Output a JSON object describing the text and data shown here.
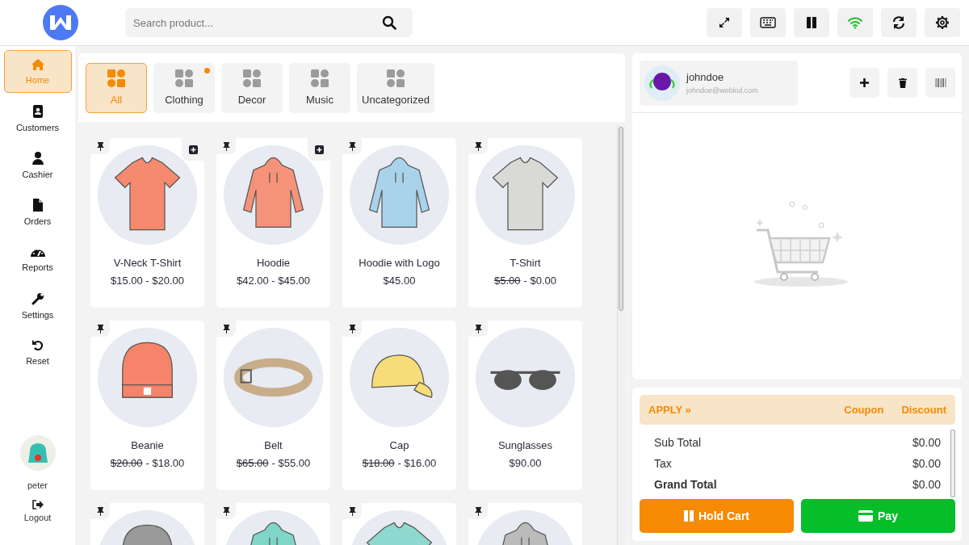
{
  "header": {
    "search": {
      "placeholder": "Search product..."
    },
    "tools": [
      {
        "kind": "expand"
      },
      {
        "kind": "keyboard"
      },
      {
        "kind": "pause"
      },
      {
        "kind": "wifi",
        "on": true
      },
      {
        "kind": "refresh"
      },
      {
        "kind": "settings"
      }
    ]
  },
  "sidebar": {
    "items": [
      {
        "label": "Home",
        "kind": "home",
        "selected": true
      },
      {
        "label": "Customers",
        "kind": "contacts",
        "selected": false
      },
      {
        "label": "Cashier",
        "kind": "user",
        "selected": false
      },
      {
        "label": "Orders",
        "kind": "file",
        "selected": false
      },
      {
        "label": "Reports",
        "kind": "gauge",
        "selected": false
      },
      {
        "label": "Settings",
        "kind": "wrench",
        "selected": false
      },
      {
        "label": "Reset",
        "kind": "undo",
        "selected": false
      }
    ],
    "user": {
      "name": "peter"
    },
    "logout": "Logout"
  },
  "categories": [
    {
      "label": "All",
      "selected": true,
      "dot": false
    },
    {
      "label": "Clothing",
      "selected": false,
      "dot": true
    },
    {
      "label": "Decor",
      "selected": false,
      "dot": false
    },
    {
      "label": "Music",
      "selected": false,
      "dot": false
    },
    {
      "label": "Uncategorized",
      "selected": false,
      "dot": false
    }
  ],
  "products": [
    {
      "name": "V-Neck T-Shirt",
      "price": "$15.00 - $20.00",
      "kind": "tshirt",
      "color": "#f58a6e",
      "variants": true
    },
    {
      "name": "Hoodie",
      "price": "$42.00 - $45.00",
      "kind": "hoodie",
      "color": "#f5927a",
      "variants": true
    },
    {
      "name": "Hoodie with Logo",
      "price": "$45.00",
      "kind": "hoodie",
      "color": "#a9d3ea",
      "variants": false
    },
    {
      "name": "T-Shirt",
      "old_price": "$5.00",
      "price": "- $0.00",
      "kind": "tshirt",
      "color": "#d9d9d6",
      "variants": false
    },
    {
      "name": "Beanie",
      "old_price": "$20.00",
      "price": "- $18.00",
      "kind": "beanie",
      "color": "#f5846a",
      "variants": false
    },
    {
      "name": "Belt",
      "old_price": "$65.00",
      "price": "- $55.00",
      "kind": "belt",
      "color": "#c8ad8a",
      "variants": false
    },
    {
      "name": "Cap",
      "old_price": "$18.00",
      "price": "- $16.00",
      "kind": "cap",
      "color": "#f7dc7a",
      "variants": false
    },
    {
      "name": "Sunglasses",
      "price": "$90.00",
      "kind": "sunglasses",
      "color": "#555555",
      "variants": false
    },
    {
      "kind": "beanie",
      "color": "#9a9a9a",
      "variants": false
    },
    {
      "kind": "hoodie",
      "color": "#7fd6c8",
      "variants": false
    },
    {
      "kind": "tshirt",
      "color": "#8fd8cf",
      "variants": false
    },
    {
      "kind": "hoodie",
      "color": "#bbbbbb",
      "variants": false
    }
  ],
  "cart": {
    "customer": {
      "name": "johndoe",
      "email": "johndoe@webkul.com"
    },
    "actions": [
      {
        "kind": "plus"
      },
      {
        "kind": "trash"
      },
      {
        "kind": "barcode"
      }
    ],
    "apply": {
      "label": "APPLY »",
      "coupon": "Coupon",
      "discount": "Discount"
    },
    "totals": [
      {
        "label": "Sub Total",
        "value": "$0.00",
        "bold": false
      },
      {
        "label": "Tax",
        "value": "$0.00",
        "bold": false
      },
      {
        "label": "Grand Total",
        "value": "$0.00",
        "bold": true
      }
    ],
    "hold": "Hold Cart",
    "pay": "Pay"
  }
}
